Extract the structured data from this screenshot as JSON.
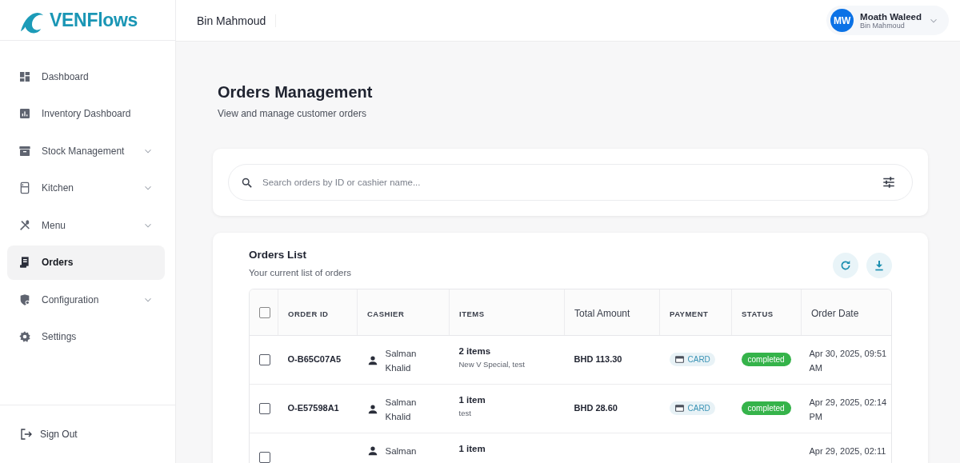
{
  "brand": {
    "name": "VENFlows"
  },
  "header": {
    "title": "Bin Mahmoud",
    "user": {
      "initials": "MW",
      "name": "Moath Waleed",
      "subtitle": "Bin Mahmoud"
    }
  },
  "sidebar": {
    "items": [
      {
        "label": "Dashboard",
        "selected": false,
        "expandable": false
      },
      {
        "label": "Inventory Dashboard",
        "selected": false,
        "expandable": false
      },
      {
        "label": "Stock Management",
        "selected": false,
        "expandable": true
      },
      {
        "label": "Kitchen",
        "selected": false,
        "expandable": true
      },
      {
        "label": "Menu",
        "selected": false,
        "expandable": true
      },
      {
        "label": "Orders",
        "selected": true,
        "expandable": false
      },
      {
        "label": "Configuration",
        "selected": false,
        "expandable": true
      },
      {
        "label": "Settings",
        "selected": false,
        "expandable": false
      }
    ],
    "sign_out": "Sign Out"
  },
  "page": {
    "title": "Orders Management",
    "subtitle": "View and manage customer orders"
  },
  "search": {
    "placeholder": "Search orders by ID or cashier name..."
  },
  "orders": {
    "title": "Orders List",
    "subtitle": "Your current list of orders",
    "table": {
      "select_all_checked": false,
      "columns": [
        "ORDER ID",
        "CASHIER",
        "ITEMS",
        "Total Amount",
        "PAYMENT",
        "STATUS",
        "Order Date"
      ],
      "rows": [
        {
          "checked": false,
          "order_id": "O-B65C07A5",
          "cashier": "Salman Khalid",
          "items_count": "2 items",
          "items_detail": "New V Special, test",
          "total": "BHD 113.30",
          "payment": "CARD",
          "status": "completed",
          "date": "Apr 30, 2025, 09:51 AM"
        },
        {
          "checked": false,
          "order_id": "O-E57598A1",
          "cashier": "Salman Khalid",
          "items_count": "1 item",
          "items_detail": "test",
          "total": "BHD 28.60",
          "payment": "CARD",
          "status": "completed",
          "date": "Apr 29, 2025, 02:14 PM"
        },
        {
          "checked": false,
          "cashier": "Salman",
          "items_count": "1 item",
          "date": "Apr 29, 2025, 02:11"
        }
      ]
    }
  }
}
